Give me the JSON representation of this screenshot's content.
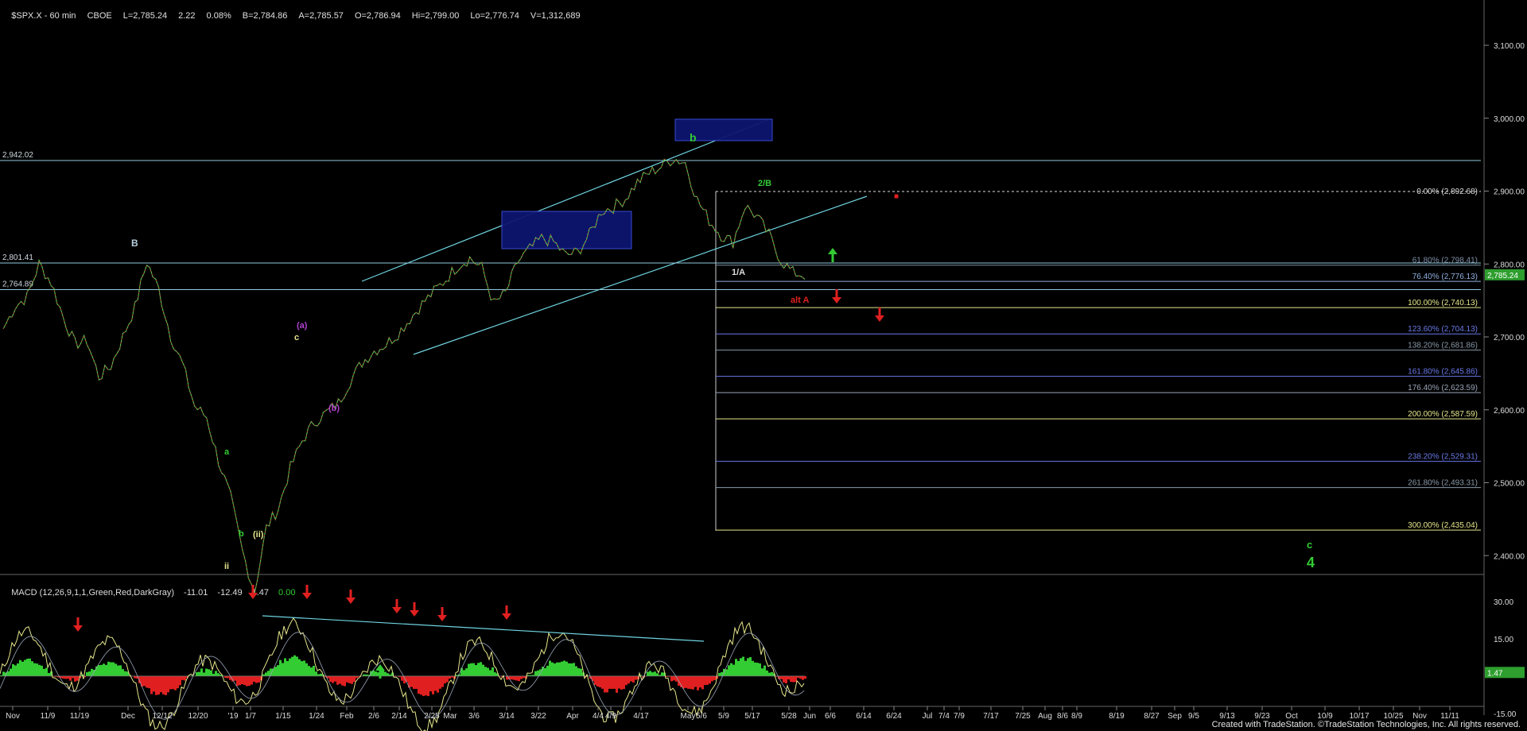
{
  "header": {
    "symbol": "$SPX.X - 60 min",
    "exchange": "CBOE",
    "last": "L=2,785.24",
    "change": "2.22",
    "change_pct": "0.08%",
    "bid": "B=2,784.86",
    "ask": "A=2,785.57",
    "open": "O=2,786.94",
    "high": "Hi=2,799.00",
    "low": "Lo=2,776.74",
    "volume": "V=1,312,689"
  },
  "macd": {
    "label": "MACD (12,26,9,1,1,Green,Red,DarkGray)",
    "v1": "-11.01",
    "v2": "-12.49",
    "v3": "1.47",
    "v4": "0.00",
    "current_tag": "1.47"
  },
  "footer": "Created with TradeStation. ©TradeStation Technologies, Inc. All rights reserved.",
  "colors": {
    "green": "#33cc33",
    "red": "#e02020",
    "cyan": "#6fd3e0",
    "yellow": "#e6e68c",
    "purple": "#b040d0",
    "blue": "#5a78e0",
    "fibgray": "#9aa6b8"
  },
  "chart_data": {
    "type": "line",
    "title": "$SPX.X - 60 min",
    "price_axis": {
      "ticks": [
        "3,100.00",
        "3,000.00",
        "2,900.00",
        "2,800.00",
        "2,700.00",
        "2,600.00",
        "2,500.00",
        "2,400.00"
      ],
      "values": [
        3100,
        3000,
        2900,
        2800,
        2700,
        2600,
        2500,
        2400
      ],
      "current_tag": "2,785.24"
    },
    "macd_axis": {
      "ticks": [
        "30.00",
        "15.00",
        "-15.00"
      ],
      "values": [
        30,
        15,
        -15
      ]
    },
    "date_ticks": [
      "Nov",
      "11/9",
      "11/19",
      "Dec",
      "12/12",
      "12/20",
      "'19",
      "1/7",
      "1/15",
      "1/24",
      "Feb",
      "2/6",
      "2/14",
      "2/25",
      "Mar",
      "3/6",
      "3/14",
      "3/22",
      "Apr",
      "4/4",
      "4/9",
      "4/17",
      "May",
      "5/6",
      "5/9",
      "5/17",
      "5/28",
      "Jun",
      "6/6",
      "6/14",
      "6/24",
      "Jul",
      "7/4",
      "7/9",
      "7/17",
      "7/25",
      "Aug",
      "8/6",
      "8/9",
      "8/19",
      "8/27",
      "Sep",
      "9/5",
      "9/13",
      "9/23",
      "Oct",
      "10/9",
      "10/17",
      "10/25",
      "Nov",
      "11/11"
    ],
    "price_series": [
      2711,
      2742,
      2755,
      2800,
      2775,
      2728,
      2690,
      2695,
      2645,
      2660,
      2700,
      2740,
      2803,
      2765,
      2701,
      2662,
      2605,
      2590,
      2530,
      2480,
      2405,
      2350,
      2438,
      2465,
      2520,
      2558,
      2583,
      2596,
      2609,
      2640,
      2665,
      2681,
      2690,
      2705,
      2725,
      2745,
      2762,
      2779,
      2798,
      2808,
      2795,
      2745,
      2760,
      2803,
      2820,
      2835,
      2830,
      2812,
      2816,
      2840,
      2873,
      2878,
      2890,
      2912,
      2925,
      2934,
      2945,
      2939,
      2888,
      2860,
      2840,
      2830,
      2880,
      2865,
      2840,
      2805,
      2788,
      2785
    ],
    "horizontal_levels": [
      {
        "label": "2,942.02",
        "value": 2942.02
      },
      {
        "label": "2,801.41",
        "value": 2801.41
      },
      {
        "label": "2,764.89",
        "value": 2764.89
      }
    ],
    "fib_levels": [
      {
        "label": "0.00% (2,892.68)",
        "value": 2892.68
      },
      {
        "label": "61.80% (2,798.41)",
        "value": 2798.41
      },
      {
        "label": "76.40% (2,776.13)",
        "value": 2776.13
      },
      {
        "label": "100.00% (2,740.13)",
        "value": 2740.13
      },
      {
        "label": "123.60% (2,704.13)",
        "value": 2704.13
      },
      {
        "label": "138.20% (2,681.86)",
        "value": 2681.86
      },
      {
        "label": "161.80% (2,645.86)",
        "value": 2645.86
      },
      {
        "label": "176.40% (2,623.59)",
        "value": 2623.59
      },
      {
        "label": "200.00% (2,587.59)",
        "value": 2587.59
      },
      {
        "label": "238.20% (2,529.31)",
        "value": 2529.31
      },
      {
        "label": "261.80% (2,493.31)",
        "value": 2493.31
      },
      {
        "label": "300.00% (2,435.04)",
        "value": 2435.04
      }
    ],
    "wave_labels": [
      "B",
      "(a)",
      "c",
      "(b)",
      "a",
      "b",
      "(ii)",
      "ii",
      "b",
      "2/B",
      "1/A",
      "alt A",
      "c",
      "4"
    ]
  }
}
